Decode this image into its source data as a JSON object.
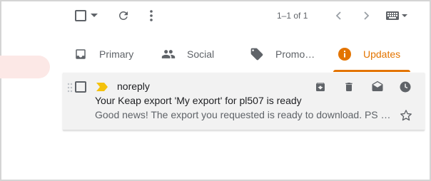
{
  "toolbar": {
    "select_icon": "checkbox-icon",
    "dropdown_icon": "caret-down-icon",
    "refresh_icon": "refresh-icon",
    "more_icon": "more-vert-icon",
    "pagination": "1–1 of 1",
    "prev_icon": "chevron-left-icon",
    "next_icon": "chevron-right-icon",
    "keyboard_icon": "keyboard-icon"
  },
  "tabs": [
    {
      "label": "Primary",
      "icon": "inbox-icon"
    },
    {
      "label": "Social",
      "icon": "people-icon"
    },
    {
      "label": "Promo…",
      "icon": "tag-icon"
    },
    {
      "label": "Updates",
      "icon": "info-icon",
      "active": true
    }
  ],
  "email": {
    "sender": "noreply",
    "subject": "Your Keap export 'My export' for pl507 is ready",
    "snippet": "Good news! The export you requested is ready to download. PS …",
    "actions": [
      "archive-icon",
      "delete-icon",
      "mark-read-icon",
      "snooze-icon"
    ]
  },
  "colors": {
    "accent": "#e37400",
    "importance": "#f4c20d",
    "row_bg": "#f2f2f2",
    "left_pill": "#fce8e6"
  }
}
